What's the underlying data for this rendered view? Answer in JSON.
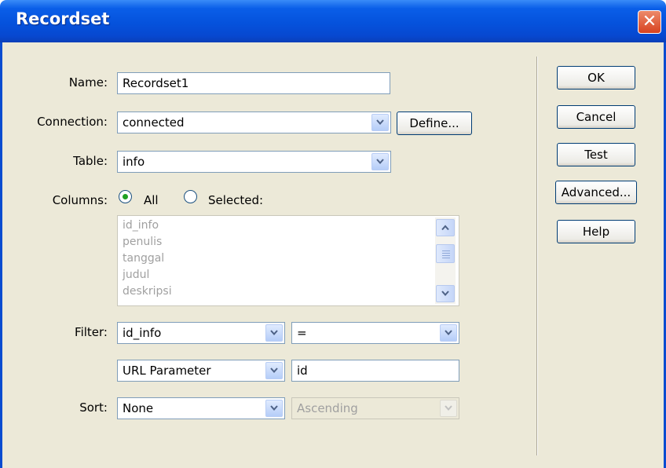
{
  "window": {
    "title": "Recordset",
    "close_symbol": "✕"
  },
  "form": {
    "name_label": "Name:",
    "name_value": "Recordset1",
    "connection_label": "Connection:",
    "connection_value": "connected",
    "define_button": "Define...",
    "table_label": "Table:",
    "table_value": "info",
    "columns_label": "Columns:",
    "columns_all_label": "All",
    "columns_selected_label": "Selected:",
    "columns_selected_option": "All",
    "columns_list": [
      "id_info",
      "penulis",
      "tanggal",
      "judul",
      "deskripsi"
    ],
    "filter_label": "Filter:",
    "filter_column": "id_info",
    "filter_operator": "=",
    "filter_source": "URL Parameter",
    "filter_value": "id",
    "sort_label": "Sort:",
    "sort_column": "None",
    "sort_order": "Ascending"
  },
  "buttons": {
    "ok": "OK",
    "cancel": "Cancel",
    "test": "Test",
    "advanced": "Advanced...",
    "help": "Help"
  },
  "colors": {
    "titlebar": "#0552dc",
    "dialog_bg": "#ece9d8",
    "disabled_text": "#a0a0a0",
    "radio_dot": "#21a121"
  }
}
